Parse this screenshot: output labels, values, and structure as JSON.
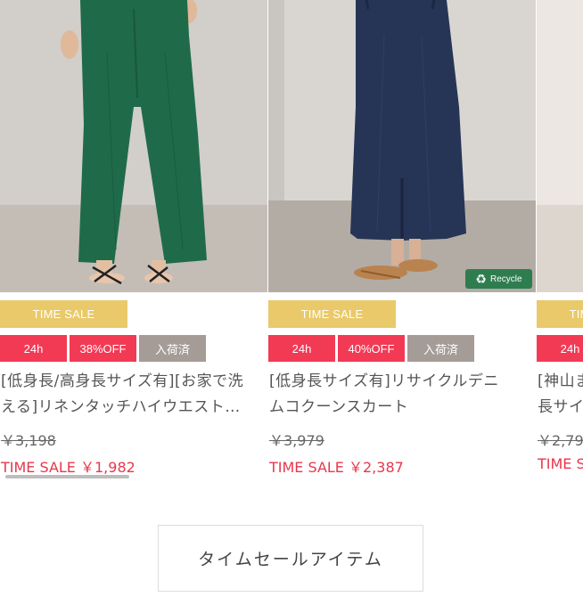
{
  "products": [
    {
      "sale_banner": "TIME SALE",
      "tag_24h": "24h",
      "tag_discount": "38%OFF",
      "tag_stock": "入荷済",
      "name_line1": "[低身長/高身長サイズ有][お家で洗",
      "name_line2": "える]リネンタッチハイウエスト…",
      "original_price": "￥3,198",
      "sale_price": "TIME SALE ￥1,982",
      "badge": ""
    },
    {
      "sale_banner": "TIME SALE",
      "tag_24h": "24h",
      "tag_discount": "40%OFF",
      "tag_stock": "入荷済",
      "name_line1": "[低身長サイズ有]リサイクルデニ",
      "name_line2": "ムコクーンスカート",
      "original_price": "￥3,979",
      "sale_price": "TIME SALE ￥2,387",
      "badge": "Recycle"
    },
    {
      "sale_banner": "TIME SALE",
      "tag_24h": "24h",
      "tag_discount": "",
      "tag_stock": "",
      "name_line1": "[神山ま",
      "name_line2": "長サイ",
      "original_price": "￥2,79",
      "sale_price": "TIME S",
      "badge": ""
    }
  ],
  "more_button_label": "タイムセールアイテム",
  "icons": {
    "recycle": "recycle-icon"
  },
  "colors": {
    "sale_banner": "#e9c96a",
    "tag_red": "#f23a55",
    "tag_gray": "#a59b97",
    "sale_price": "#e8374c"
  }
}
